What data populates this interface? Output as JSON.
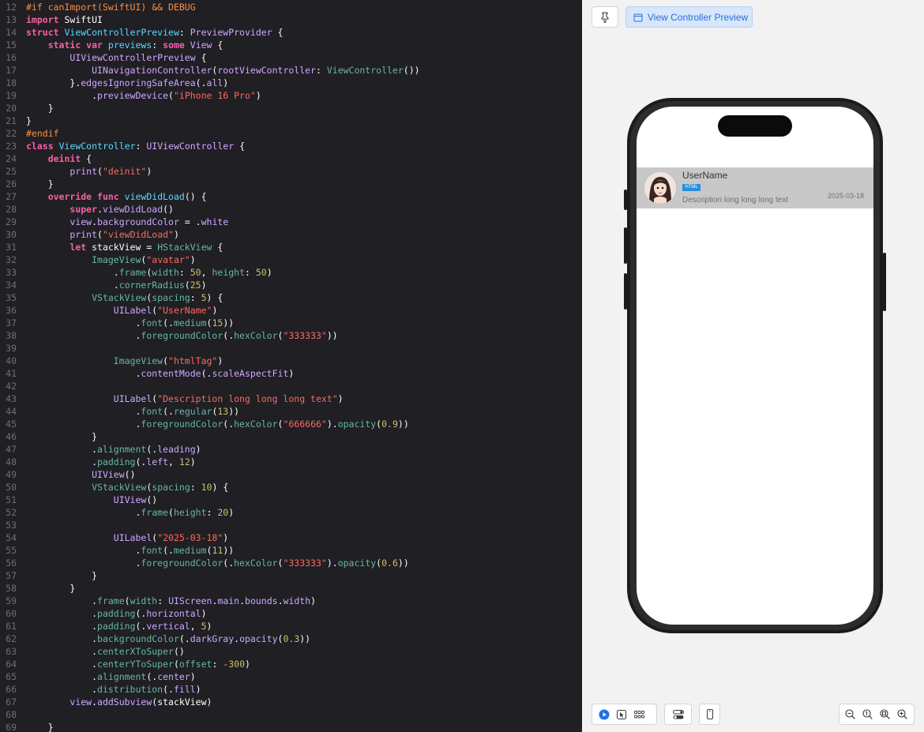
{
  "editor": {
    "lines": [
      {
        "n": "12",
        "html": "<span class='pp'>#if canImport(SwiftUI) &amp;&amp; DEBUG</span>"
      },
      {
        "n": "13",
        "html": "<span class='k'>import</span> SwiftUI"
      },
      {
        "n": "14",
        "html": "<span class='k'>struct</span> <span class='t'>ViewControllerPreview</span>: <span class='sys'>PreviewProvider</span> {"
      },
      {
        "n": "15",
        "html": "    <span class='k'>static var</span> <span class='t'>previews</span>: <span class='k'>some</span> <span class='sys'>View</span> {"
      },
      {
        "n": "16",
        "html": "        <span class='sys'>UIViewControllerPreview</span> {"
      },
      {
        "n": "17",
        "html": "            <span class='sys'>UINavigationController</span>(<span class='sys'>rootViewController</span>: <span class='fn'>ViewController</span>())"
      },
      {
        "n": "18",
        "html": "        }.<span class='sys'>edgesIgnoringSafeArea</span>(.<span class='sys'>all</span>)"
      },
      {
        "n": "19",
        "html": "            .<span class='sys'>previewDevice</span>(<span class='s'>\"iPhone 16 Pro\"</span>)"
      },
      {
        "n": "20",
        "html": "    }"
      },
      {
        "n": "21",
        "html": "}"
      },
      {
        "n": "22",
        "html": "<span class='pp'>#endif</span>"
      },
      {
        "n": "23",
        "html": "<span class='k'>class</span> <span class='t'>ViewController</span>: <span class='sys'>UIViewController</span> {"
      },
      {
        "n": "24",
        "html": "    <span class='k'>deinit</span> {"
      },
      {
        "n": "25",
        "html": "        <span class='sys'>print</span>(<span class='s'>\"deinit\"</span>)"
      },
      {
        "n": "26",
        "html": "    }"
      },
      {
        "n": "27",
        "html": "    <span class='k'>override func</span> <span class='t'>viewDidLoad</span>() {"
      },
      {
        "n": "28",
        "html": "        <span class='k'>super</span>.<span class='sys'>viewDidLoad</span>()"
      },
      {
        "n": "29",
        "html": "        <span class='sys'>view</span>.<span class='sys'>backgroundColor</span> = .<span class='sys'>white</span>"
      },
      {
        "n": "30",
        "html": "        <span class='sys'>print</span>(<span class='s'>\"viewDidLoad\"</span>)"
      },
      {
        "n": "31",
        "html": "        <span class='k'>let</span> stackView = <span class='fn'>HStackView</span> {"
      },
      {
        "n": "32",
        "html": "            <span class='fn'>ImageView</span>(<span class='s'>\"avatar\"</span>)"
      },
      {
        "n": "33",
        "html": "                .<span class='fn'>frame</span>(<span class='fn'>width</span>: <span class='n'>50</span>, <span class='fn'>height</span>: <span class='n'>50</span>)"
      },
      {
        "n": "34",
        "html": "                .<span class='fn'>cornerRadius</span>(<span class='n'>25</span>)"
      },
      {
        "n": "35",
        "html": "            <span class='fn'>VStackView</span>(<span class='fn'>spacing</span>: <span class='n'>5</span>) {"
      },
      {
        "n": "36",
        "html": "                <span class='sys'>UILabel</span>(<span class='s'>\"UserName\"</span>)"
      },
      {
        "n": "37",
        "html": "                    .<span class='fn'>font</span>(.<span class='fn'>medium</span>(<span class='n'>15</span>))"
      },
      {
        "n": "38",
        "html": "                    .<span class='fn'>foregroundColor</span>(.<span class='fn'>hexColor</span>(<span class='s'>\"333333\"</span>))"
      },
      {
        "n": "39",
        "html": ""
      },
      {
        "n": "40",
        "html": "                <span class='fn'>ImageView</span>(<span class='s'>\"htmlTag\"</span>)"
      },
      {
        "n": "41",
        "html": "                    .<span class='sys'>contentMode</span>(.<span class='sys'>scaleAspectFit</span>)"
      },
      {
        "n": "42",
        "html": ""
      },
      {
        "n": "43",
        "html": "                <span class='sys'>UILabel</span>(<span class='s'>\"Description long long long text\"</span>)"
      },
      {
        "n": "44",
        "html": "                    .<span class='fn'>font</span>(.<span class='fn'>regular</span>(<span class='n'>13</span>))"
      },
      {
        "n": "45",
        "html": "                    .<span class='fn'>foregroundColor</span>(.<span class='fn'>hexColor</span>(<span class='s'>\"666666\"</span>).<span class='fn'>opacity</span>(<span class='n'>0.9</span>))"
      },
      {
        "n": "46",
        "html": "            }"
      },
      {
        "n": "47",
        "html": "            .<span class='fn'>alignment</span>(.<span class='sys'>leading</span>)"
      },
      {
        "n": "48",
        "html": "            .<span class='fn'>padding</span>(.<span class='sys'>left</span>, <span class='n'>12</span>)"
      },
      {
        "n": "49",
        "html": "            <span class='sys'>UIView</span>()"
      },
      {
        "n": "50",
        "html": "            <span class='fn'>VStackView</span>(<span class='fn'>spacing</span>: <span class='n'>10</span>) {"
      },
      {
        "n": "51",
        "html": "                <span class='sys'>UIView</span>()"
      },
      {
        "n": "52",
        "html": "                    .<span class='fn'>frame</span>(<span class='fn'>height</span>: <span class='n'>20</span>)"
      },
      {
        "n": "53",
        "html": ""
      },
      {
        "n": "54",
        "html": "                <span class='sys'>UILabel</span>(<span class='s'>\"2025-03-18\"</span>)"
      },
      {
        "n": "55",
        "html": "                    .<span class='fn'>font</span>(.<span class='fn'>medium</span>(<span class='n'>11</span>))"
      },
      {
        "n": "56",
        "html": "                    .<span class='fn'>foregroundColor</span>(.<span class='fn'>hexColor</span>(<span class='s'>\"333333\"</span>).<span class='fn'>opacity</span>(<span class='n'>0.6</span>))"
      },
      {
        "n": "57",
        "html": "            }"
      },
      {
        "n": "58",
        "html": "        }"
      },
      {
        "n": "59",
        "html": "            .<span class='fn'>frame</span>(<span class='fn'>width</span>: <span class='sys'>UIScreen</span>.<span class='sys'>main</span>.<span class='sys'>bounds</span>.<span class='sys'>width</span>)"
      },
      {
        "n": "60",
        "html": "            .<span class='fn'>padding</span>(.<span class='sys'>horizontal</span>)"
      },
      {
        "n": "61",
        "html": "            .<span class='fn'>padding</span>(.<span class='sys'>vertical</span>, <span class='n'>5</span>)"
      },
      {
        "n": "62",
        "html": "            .<span class='fn'>backgroundColor</span>(.<span class='sys'>darkGray</span>.<span class='sys'>opacity</span>(<span class='n'>0.3</span>))"
      },
      {
        "n": "63",
        "html": "            .<span class='fn'>centerXToSuper</span>()"
      },
      {
        "n": "64",
        "html": "            .<span class='fn'>centerYToSuper</span>(<span class='fn'>offset</span>: <span class='n'>-300</span>)"
      },
      {
        "n": "65",
        "html": "            .<span class='fn'>alignment</span>(.<span class='sys'>center</span>)"
      },
      {
        "n": "66",
        "html": "            .<span class='fn'>distribution</span>(.<span class='sys'>fill</span>)"
      },
      {
        "n": "67",
        "html": "        <span class='sys'>view</span>.<span class='sys'>addSubview</span>(stackView)"
      },
      {
        "n": "68",
        "html": ""
      },
      {
        "n": "69",
        "html": "    }"
      }
    ]
  },
  "preview": {
    "pin_icon": "pin-icon",
    "tab_label": "View Controller Preview",
    "tab_icon": "preview-window-icon",
    "cell": {
      "username": "UserName",
      "tag": "HTML",
      "description": "Description long long long text",
      "date": "2025-03-18",
      "avatar_icon": "avatar-portrait"
    },
    "bottom_left": [
      "play-icon",
      "cursor-select-icon",
      "grid-icon"
    ],
    "bottom_mid": "variants-icon",
    "bottom_device": "device-icon",
    "zoom_icons": [
      "zoom-out-icon",
      "zoom-100-icon",
      "zoom-fit-icon",
      "zoom-in-icon"
    ]
  },
  "colors": {
    "editor_bg": "#1f1f24",
    "keyword": "#fc5fa3",
    "string": "#fc6a5d",
    "number": "#d0bf69",
    "preview_bg": "#f2f2f3",
    "accent": "#2b6fd6"
  }
}
